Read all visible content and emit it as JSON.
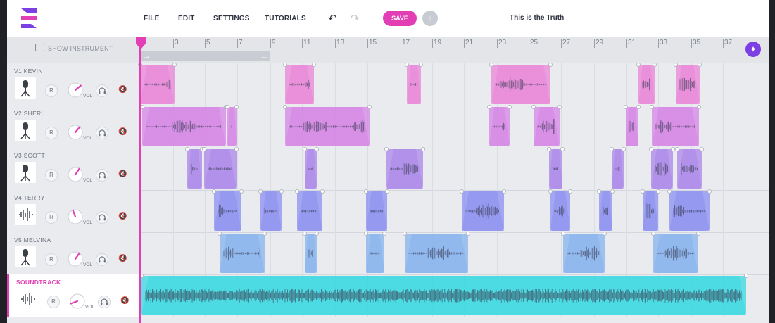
{
  "menu": {
    "file": "FILE",
    "edit": "EDIT",
    "settings": "SETTINGS",
    "tutorials": "TUTORIALS"
  },
  "toolbar": {
    "save_label": "SAVE",
    "project_title": "This is the Truth"
  },
  "ruler": {
    "show_instrument_label": "SHOW INSTRUMENT",
    "ticks": [
      "3",
      "5",
      "7",
      "9",
      "11",
      "13",
      "15",
      "17",
      "19",
      "21",
      "23",
      "25",
      "27",
      "29",
      "31",
      "33",
      "35",
      "37"
    ]
  },
  "colors": {
    "accent": "#e23fb5",
    "purple_button": "#7b3fe4",
    "soundtrack_clip": "#38d8e0"
  },
  "tracks": [
    {
      "name": "V1 KEVIN",
      "r_label": "R",
      "vol_label": "VOL",
      "icon": "microphone-icon",
      "color": "#ea84d8",
      "clip_count": 6
    },
    {
      "name": "V2 SHERI",
      "r_label": "R",
      "vol_label": "VOL",
      "icon": "microphone-icon",
      "color": "#d684e6",
      "clip_count": 7
    },
    {
      "name": "V3 SCOTT",
      "r_label": "R",
      "vol_label": "VOL",
      "icon": "microphone-icon",
      "color": "#ab86ea",
      "clip_count": 8
    },
    {
      "name": "V4 TERRY",
      "r_label": "R",
      "vol_label": "VOL",
      "icon": "waveform-icon",
      "color": "#8b8ff0",
      "clip_count": 9
    },
    {
      "name": "V5 MELVINA",
      "r_label": "R",
      "vol_label": "VOL",
      "icon": "microphone-icon",
      "color": "#86b3ee",
      "clip_count": 7
    },
    {
      "name": "SOUNDTRACK",
      "r_label": "R",
      "vol_label": "VOL",
      "icon": "waveform-icon",
      "color": "#38d8e0",
      "clip_count": 1
    }
  ]
}
